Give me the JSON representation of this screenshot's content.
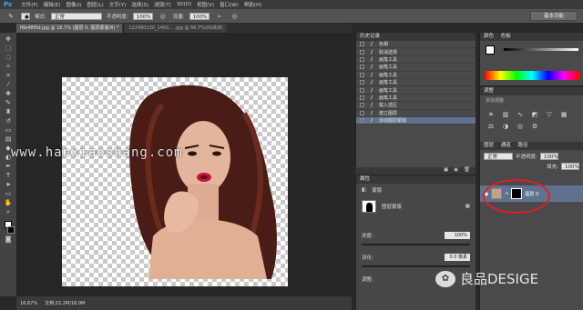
{
  "app": {
    "logo": "Ps"
  },
  "menu": [
    "文件(F)",
    "编辑(E)",
    "图像(I)",
    "图层(L)",
    "文字(Y)",
    "选择(S)",
    "滤镜(T)",
    "3D(D)",
    "视图(V)",
    "窗口(W)",
    "帮助(H)"
  ],
  "options": {
    "mode_label": "模式:",
    "mode_value": "正常",
    "opacity_label": "不透明度:",
    "opacity_value": "100%",
    "flow_label": "流量:",
    "flow_value": "100%",
    "workspace": "基本功能"
  },
  "tabs": [
    {
      "label": "f6b48f0d.jpg @ 16.7% (图层 0, 图层蒙版/8) *"
    },
    {
      "label": "122480130_1460... .jpg @ 66.7%(RGB/8)"
    }
  ],
  "status": {
    "zoom": "16.67%",
    "doc": "文档:22.2M/16.0M"
  },
  "watermark": "www.hanxiaoshang.com",
  "brand": "良品DESIGE",
  "history": {
    "title": "历史记录",
    "items": [
      {
        "label": "色相"
      },
      {
        "label": "取消选择"
      },
      {
        "label": "画笔工具"
      },
      {
        "label": "画笔工具"
      },
      {
        "label": "画笔工具"
      },
      {
        "label": "画笔工具"
      },
      {
        "label": "画笔工具"
      },
      {
        "label": "画笔工具"
      },
      {
        "label": "载入选区"
      },
      {
        "label": "建立图层"
      },
      {
        "label": "添加图层蒙版"
      }
    ]
  },
  "properties": {
    "title": "属性",
    "subtitle": "蒙版",
    "mask_label": "图层蒙版",
    "density_label": "浓度:",
    "density_value": "100%",
    "feather_label": "羽化:",
    "feather_value": "0.0 像素",
    "refine_label": "调整:"
  },
  "color_panel": {
    "title": "颜色",
    "title2": "色板"
  },
  "adjustments": {
    "title": "调整",
    "subtitle": "添加调整"
  },
  "layers": {
    "title": "图层",
    "title2": "通道",
    "title3": "路径",
    "blend": "正常",
    "opacity_label": "不透明度:",
    "opacity_value": "100%",
    "fill_label": "填充:",
    "fill_value": "100%",
    "layer_name": "图层 0"
  },
  "colors": {
    "accent_selection": "#5f7390",
    "annotation": "#e02020"
  }
}
